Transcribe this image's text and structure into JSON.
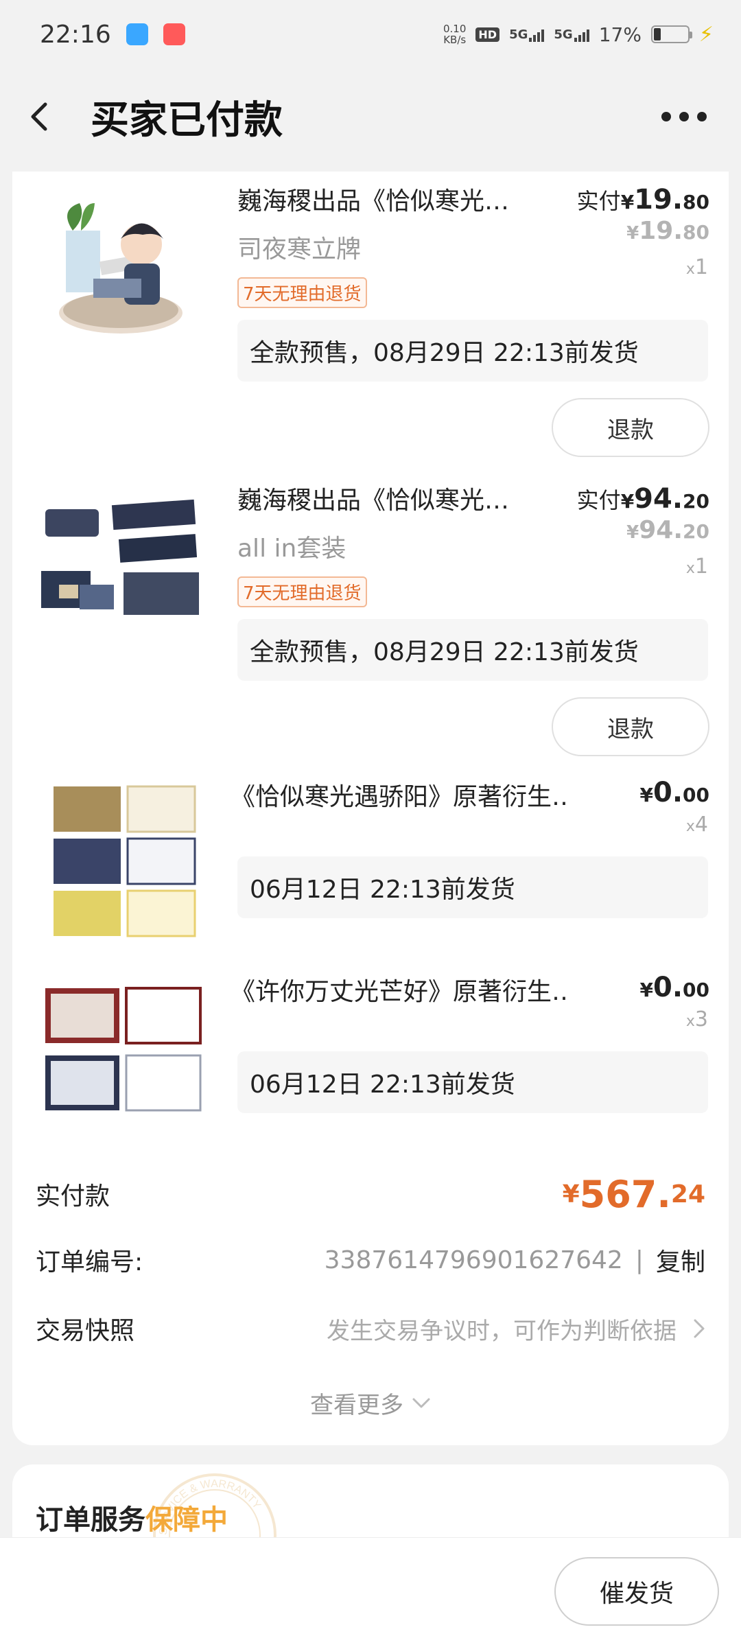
{
  "status_bar": {
    "time": "22:16",
    "net_speed_value": "0.10",
    "net_speed_unit": "KB/s",
    "hd_label": "HD",
    "sim_label_1": "5G",
    "sim_label_2": "5G",
    "battery": "17%"
  },
  "header": {
    "title": "买家已付款"
  },
  "items": [
    {
      "title": "巍海稷出品《恰似寒光…",
      "spec": "司夜寒立牌",
      "badge": "7天无理由退货",
      "price_label": "实付",
      "currency": "¥",
      "price_int": "19.",
      "price_dec": "80",
      "orig_int": "19.",
      "orig_dec": "80",
      "qty_x": "x",
      "qty": "1",
      "shipping": "全款预售，08月29日 22:13前发货",
      "refund": "退款"
    },
    {
      "title": "巍海稷出品《恰似寒光…",
      "spec": "all in套装",
      "badge": "7天无理由退货",
      "price_label": "实付",
      "currency": "¥",
      "price_int": "94.",
      "price_dec": "20",
      "orig_int": "94.",
      "orig_dec": "20",
      "qty_x": "x",
      "qty": "1",
      "shipping": "全款预售，08月29日 22:13前发货",
      "refund": "退款"
    },
    {
      "title": "《恰似寒光遇骄阳》原著衍生…",
      "currency": "¥",
      "price_int": "0.",
      "price_dec": "00",
      "qty_x": "x",
      "qty": "4",
      "shipping": "06月12日 22:13前发货"
    },
    {
      "title": "《许你万丈光芒好》原著衍生…",
      "currency": "¥",
      "price_int": "0.",
      "price_dec": "00",
      "qty_x": "x",
      "qty": "3",
      "shipping": "06月12日 22:13前发货"
    }
  ],
  "summary": {
    "paid_label": "实付款",
    "paid_currency": "¥",
    "paid_int": "567.",
    "paid_dec": "24",
    "order_label": "订单编号:",
    "order_number": "3387614796901627642",
    "separator": "|",
    "copy": "复制",
    "snapshot_label": "交易快照",
    "snapshot_desc": "发生交易争议时，可作为判断依据",
    "see_more": "查看更多"
  },
  "service": {
    "title": "订单服务",
    "status": "保障中",
    "seal_text": "SERVICE & WARRANTY"
  },
  "bottom": {
    "urge": "催发货"
  },
  "colors": {
    "accent_orange": "#e26b2a",
    "service_yellow": "#f3a93a",
    "muted_gray": "#999999",
    "bg": "#f2f2f2"
  }
}
